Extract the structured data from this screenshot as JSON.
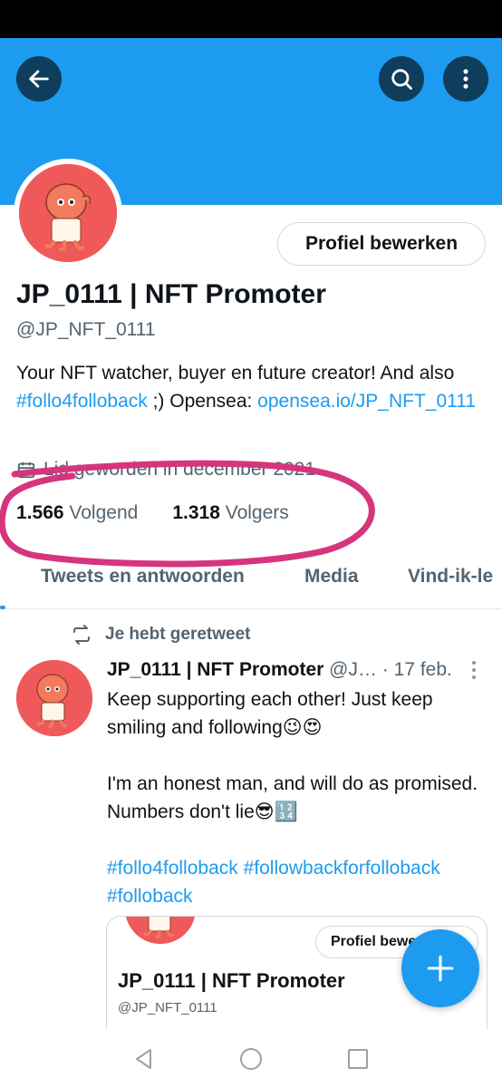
{
  "header": {
    "back_icon": "arrow-left-icon",
    "search_icon": "search-icon",
    "more_icon": "more-vertical-icon",
    "banner_color": "#1d9bf0"
  },
  "profile": {
    "edit_button": "Profiel bewerken",
    "display_name": "JP_0111 | NFT Promoter",
    "handle": "@JP_NFT_0111",
    "bio_text_1": "Your NFT watcher, buyer en future creator! And also ",
    "bio_hashtag": "#follo4folloback",
    "bio_text_2": " ;)  Opensea: ",
    "bio_link": "opensea.io/JP_NFT_0111",
    "joined": "Lid geworden in december 2021",
    "following_count": "1.566",
    "following_label": "Volgend",
    "followers_count": "1.318",
    "followers_label": "Volgers"
  },
  "tabs": [
    {
      "label": "Tweets en antwoorden"
    },
    {
      "label": "Media"
    },
    {
      "label": "Vind-ik-le"
    }
  ],
  "tweet": {
    "retweet_label": "Je hebt geretweet",
    "author_name": "JP_0111 | NFT Promoter",
    "author_handle": " @J…",
    "date": " · 17 feb.",
    "paragraph_1": "Keep supporting each other! Just keep smiling and following😉😍",
    "paragraph_2": "I'm an honest man, and will do as promised. Numbers don't lie😎🔢",
    "hashtags": "#follo4folloback #followbackforfolloback #folloback"
  },
  "quote": {
    "edit_button": "Profiel bewerken",
    "display_name": "JP_0111 | NFT Promoter",
    "handle": "@JP_NFT_0111"
  },
  "fab_icon": "plus-icon",
  "nav": {
    "back_icon": "nav-back-triangle-icon",
    "home_icon": "nav-home-circle-icon",
    "recents_icon": "nav-recents-square-icon"
  },
  "colors": {
    "accent": "#1d9bf0",
    "annotation": "#d6357d",
    "avatar": "#f0595a"
  }
}
